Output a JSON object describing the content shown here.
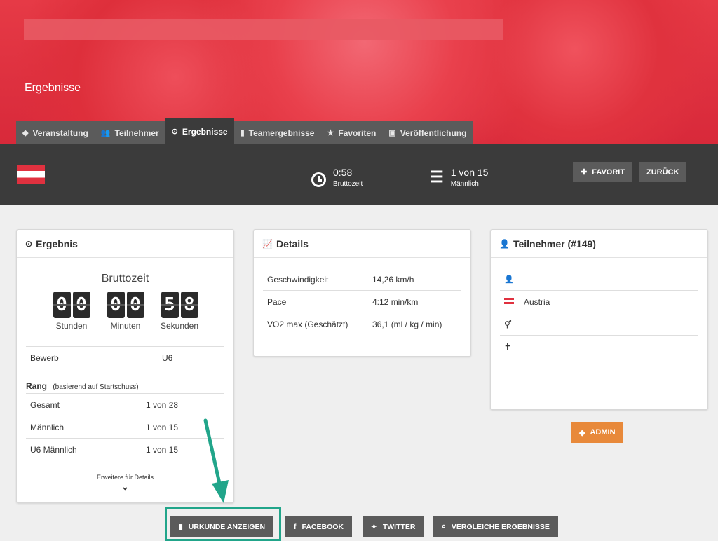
{
  "header": {
    "page_heading": "Ergebnisse",
    "tabs": [
      {
        "icon": "tag-icon",
        "glyph": "◆",
        "label": "Veranstaltung",
        "active": false
      },
      {
        "icon": "users-icon",
        "glyph": "👥",
        "label": "Teilnehmer",
        "active": false
      },
      {
        "icon": "clock-icon",
        "glyph": "⊙",
        "label": "Ergebnisse",
        "active": true
      },
      {
        "icon": "building-icon",
        "glyph": "▮",
        "label": "Teamergebnisse",
        "active": false
      },
      {
        "icon": "star-icon",
        "glyph": "★",
        "label": "Favoriten",
        "active": false
      },
      {
        "icon": "document-icon",
        "glyph": "▣",
        "label": "Veröffentlichung",
        "active": false
      }
    ]
  },
  "summary": {
    "time_value": "0:58",
    "time_label": "Bruttozeit",
    "rank_value": "1 von 15",
    "rank_label": "Männlich",
    "favorite_button": "FAVORIT",
    "back_button": "ZURÜCK"
  },
  "ergebnis": {
    "title": "Ergebnis",
    "time_title": "Bruttozeit",
    "hours": [
      "0",
      "0"
    ],
    "minutes": [
      "0",
      "0"
    ],
    "seconds": [
      "5",
      "8"
    ],
    "hours_label": "Stunden",
    "minutes_label": "Minuten",
    "seconds_label": "Sekunden",
    "bewerb_label": "Bewerb",
    "bewerb_value": "U6",
    "rang_label": "Rang",
    "rang_note": "(basierend auf Startschuss)",
    "ranks": [
      {
        "label": "Gesamt",
        "value": "1 von 28"
      },
      {
        "label": "Männlich",
        "value": "1 von 15"
      },
      {
        "label": "U6 Männlich",
        "value": "1 von 15"
      }
    ],
    "expand_text": "Erweitere für Details"
  },
  "details": {
    "title": "Details",
    "rows": [
      {
        "label": "Geschwindigkeit",
        "value": "14,26 km/h"
      },
      {
        "label": "Pace",
        "value": "4:12 min/km"
      },
      {
        "label": "VO2 max (Geschätzt)",
        "value": "36,1 (ml / kg / min)"
      }
    ]
  },
  "teilnehmer": {
    "title": "Teilnehmer (#149)",
    "country": "Austria",
    "admin_button": "ADMIN"
  },
  "actions": {
    "certificate": "URKUNDE ANZEIGEN",
    "facebook": "FACEBOOK",
    "twitter": "TWITTER",
    "compare": "VERGLEICHE ERGEBNISSE"
  },
  "colors": {
    "accent_red": "#e0313f",
    "admin_orange": "#e8893a",
    "highlight": "#21a58a"
  }
}
